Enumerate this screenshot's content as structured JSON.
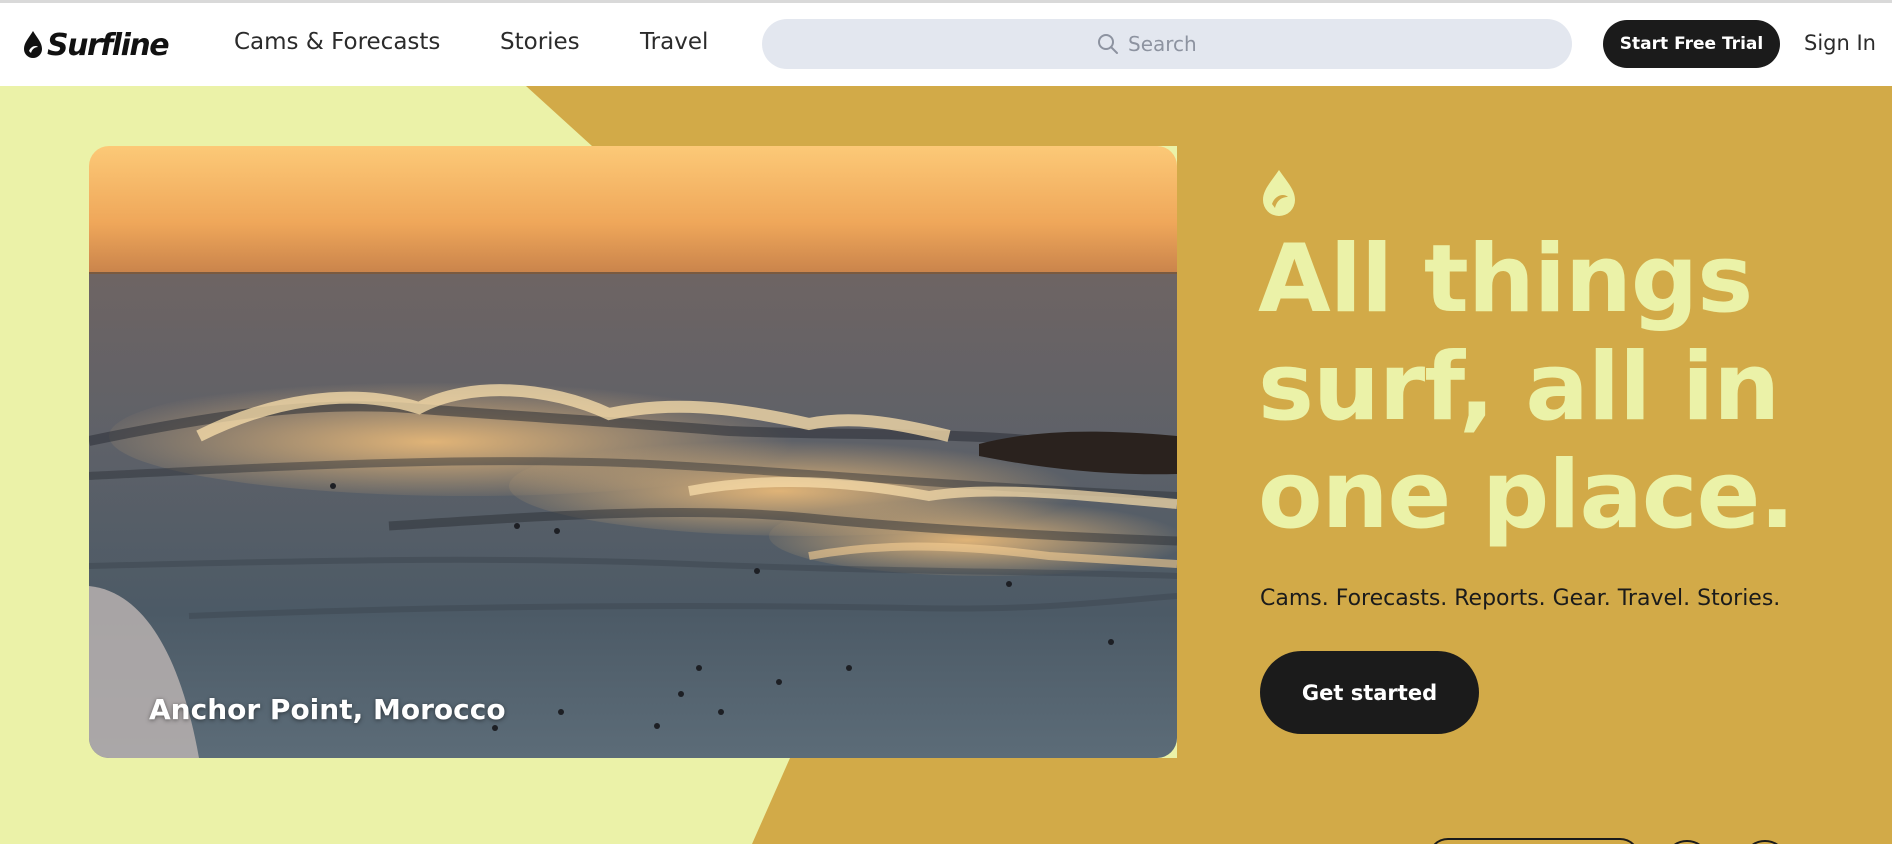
{
  "colors": {
    "hero_ochre": "#d2aa48",
    "hero_lime": "#ebf2a8",
    "dark": "#1b1b1b",
    "search_bg": "#e3e7ef"
  },
  "header": {
    "logo_icon": "surfline-drop-icon",
    "logo_text": "Surfline",
    "nav": [
      {
        "label": "Cams & Forecasts"
      },
      {
        "label": "Stories"
      },
      {
        "label": "Travel"
      }
    ],
    "search": {
      "icon": "search-icon",
      "placeholder": "Search",
      "value": ""
    },
    "trial_label": "Start Free Trial",
    "signin_label": "Sign In"
  },
  "hero": {
    "photo_caption": "Anchor Point, Morocco",
    "brand_icon": "surfline-drop-icon",
    "headline": [
      "All things",
      "surf, all in",
      "one place."
    ],
    "tagline": "Cams. Forecasts. Reports. Gear. Travel. Stories.",
    "cta_label": "Get started"
  }
}
